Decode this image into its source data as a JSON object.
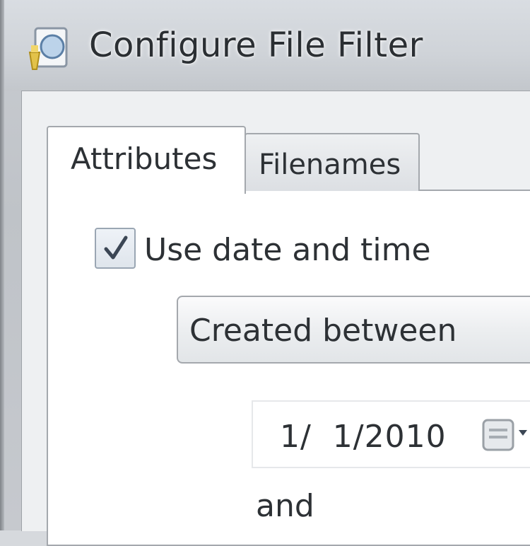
{
  "window": {
    "title": "Configure File Filter",
    "icon": "filter-config-icon"
  },
  "tabs": [
    {
      "label": "Attributes",
      "selected": true
    },
    {
      "label": "Filenames",
      "selected": false
    }
  ],
  "attributes": {
    "use_date_checkbox": {
      "label": "Use date and time",
      "checked": true
    },
    "date_mode": {
      "selected": "Created between"
    },
    "start_date": {
      "value": "1/  1/2010",
      "icon": "calendar-icon"
    },
    "and_label": "and"
  }
}
